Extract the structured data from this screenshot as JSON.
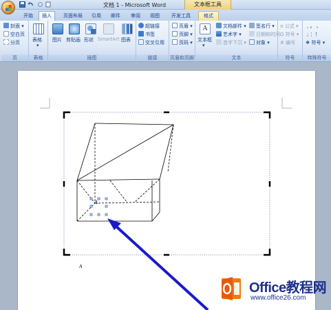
{
  "window": {
    "title": "文档 1 - Microsoft Word",
    "context_tool": "文本框工具"
  },
  "tabs": [
    "开始",
    "插入",
    "页面布局",
    "引用",
    "邮件",
    "审阅",
    "视图",
    "开发工具",
    "格式"
  ],
  "active_tab": "插入",
  "ribbon": {
    "pages": {
      "label": "页",
      "items": [
        "封面",
        "空白页",
        "分页"
      ]
    },
    "tables": {
      "label": "表格",
      "items": [
        "表格"
      ]
    },
    "illustrations": {
      "label": "插图",
      "items": [
        "图片",
        "剪贴画",
        "形状",
        "SmartArt",
        "图表"
      ]
    },
    "links": {
      "label": "链接",
      "items": [
        "超链接",
        "书签",
        "交叉引用"
      ]
    },
    "header_footer": {
      "label": "页眉和页脚",
      "items": [
        "页眉",
        "页脚",
        "页码"
      ]
    },
    "text": {
      "label": "文本",
      "items": [
        "文本框",
        "文档部件",
        "艺术字",
        "首字下沉",
        "签名行",
        "日期和时间",
        "对象"
      ]
    },
    "symbols": {
      "label": "符号",
      "items": [
        "公式",
        "符号",
        "编号"
      ]
    },
    "special": {
      "label": "特殊符号",
      "items": [
        "符号"
      ]
    }
  },
  "document": {
    "label_a_figure": "A",
    "label_a_page": "A"
  },
  "watermark": {
    "title": "Office教程网",
    "url": "www.office26.com"
  },
  "colors": {
    "arrow": "#1a1acc",
    "ribbon_text": "#15428b",
    "accent_orange": "#f07a12"
  }
}
